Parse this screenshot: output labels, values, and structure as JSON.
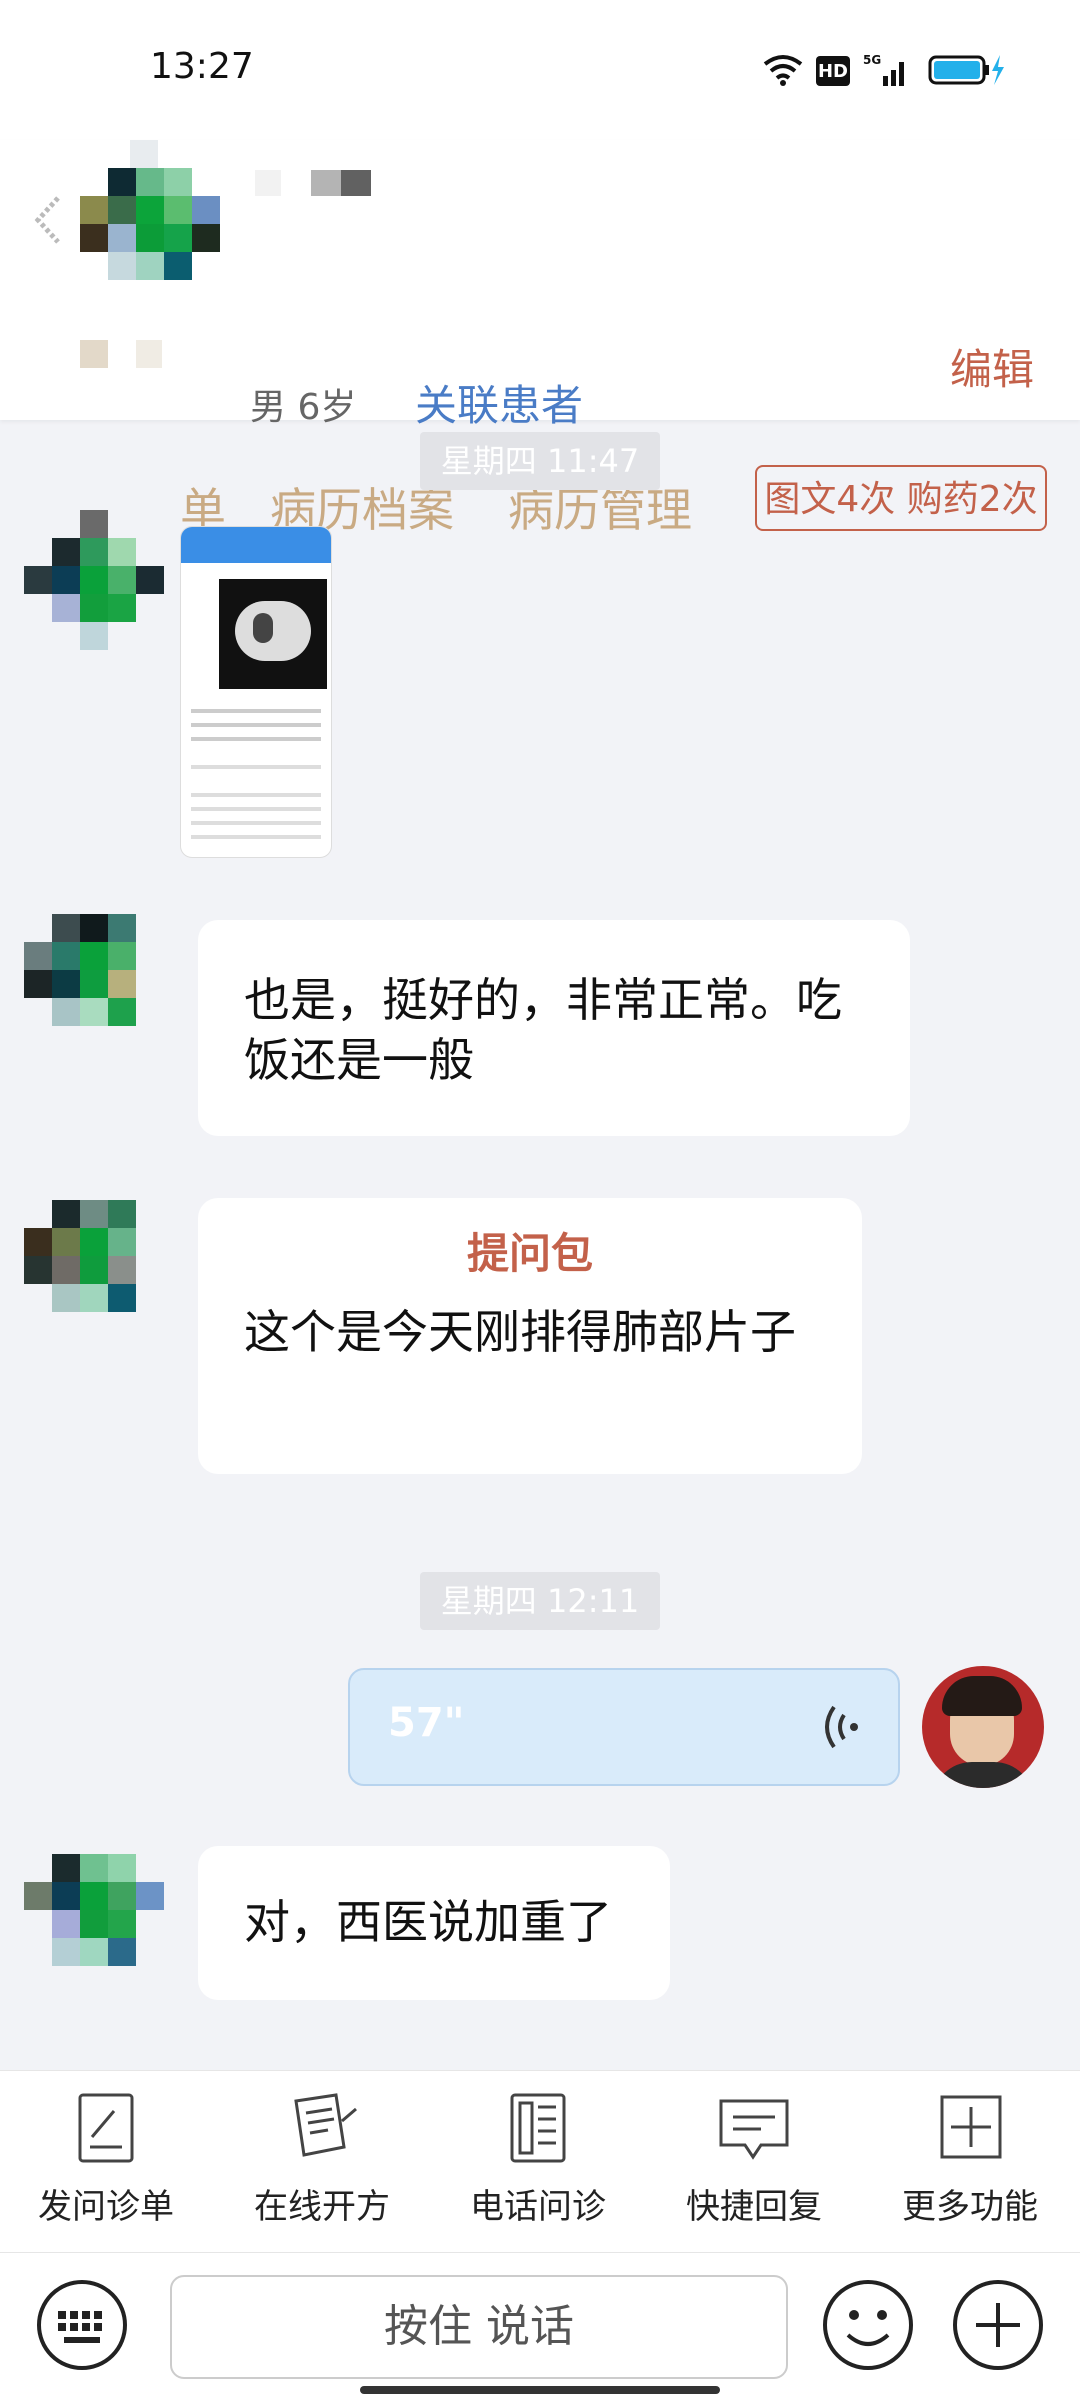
{
  "status": {
    "time": "13:27",
    "hd": "HD",
    "net": "5G"
  },
  "header": {
    "gender_age": "男 6岁",
    "link_patient": "关联患者",
    "edit": "编辑",
    "tabs": [
      "单",
      "病历档案",
      "病历管理"
    ],
    "quota": "图文4次 购药2次"
  },
  "chat": {
    "time1": "星期四 11:47",
    "msg1": "也是，挺好的，非常正常。吃饭还是一般",
    "msg2_title": "提问包",
    "msg2": "这个是今天刚排得肺部片子",
    "time2": "星期四 12:11",
    "voice_duration": "57\"",
    "msg3": "对，西医说加重了"
  },
  "toolbar": {
    "items": [
      {
        "label": "发问诊单",
        "icon": "inquiry-form-icon"
      },
      {
        "label": "在线开方",
        "icon": "prescription-icon"
      },
      {
        "label": "电话问诊",
        "icon": "phone-icon"
      },
      {
        "label": "快捷回复",
        "icon": "quick-reply-icon"
      },
      {
        "label": "更多功能",
        "icon": "more-icon"
      }
    ]
  },
  "input": {
    "hold_to_talk": "按住 说话"
  },
  "colors": {
    "accent_red": "#c3614a",
    "link_blue": "#4a7cc6",
    "tab_tan": "#c9aa83",
    "voice_bubble": "#d9ebfa"
  }
}
